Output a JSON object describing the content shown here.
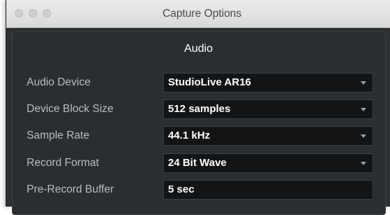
{
  "window": {
    "title": "Capture Options"
  },
  "section": {
    "title": "Audio"
  },
  "rows": [
    {
      "label": "Audio Device",
      "value": "StudioLive AR16",
      "type": "dropdown"
    },
    {
      "label": "Device Block Size",
      "value": "512 samples",
      "type": "dropdown"
    },
    {
      "label": "Sample Rate",
      "value": "44.1 kHz",
      "type": "dropdown"
    },
    {
      "label": "Record Format",
      "value": "24 Bit Wave",
      "type": "dropdown"
    },
    {
      "label": "Pre-Record Buffer",
      "value": "5 sec",
      "type": "text"
    }
  ],
  "icons": {
    "dropdown": "chevron-down-icon"
  },
  "colors": {
    "panel_bg": "#2a2e31",
    "field_bg": "#121416",
    "label": "#b8bcc0"
  }
}
